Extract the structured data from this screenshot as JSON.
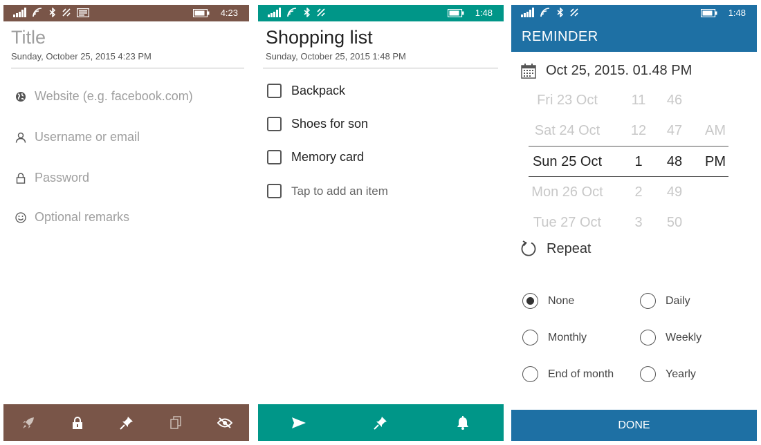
{
  "colors": {
    "brown": "#795548",
    "teal": "#009688",
    "blue": "#1e70a4"
  },
  "screen1": {
    "status": {
      "time": "4:23",
      "icons": [
        "signal-icon",
        "wifi-icon",
        "bluetooth-icon",
        "data-sense-icon",
        "message-icon",
        "battery-icon"
      ]
    },
    "title_placeholder": "Title",
    "date": "Sunday, October 25, 2015 4:23 PM",
    "fields": [
      {
        "icon": "globe-icon",
        "label": "Website (e.g. facebook.com)"
      },
      {
        "icon": "person-icon",
        "label": "Username or email"
      },
      {
        "icon": "lock-icon",
        "label": "Password"
      },
      {
        "icon": "smiley-icon",
        "label": "Optional remarks"
      }
    ],
    "appbar_icons": [
      "rocket-icon",
      "lock-icon",
      "pin-icon",
      "copy-icon",
      "hide-icon"
    ]
  },
  "screen2": {
    "status": {
      "time": "1:48",
      "icons": [
        "signal-icon",
        "wifi-icon",
        "bluetooth-icon",
        "data-sense-icon",
        "battery-icon"
      ]
    },
    "title": "Shopping list",
    "date": "Sunday, October 25, 2015 1:48 PM",
    "items": [
      "Backpack",
      "Shoes for son",
      "Memory card"
    ],
    "add_item_placeholder": "Tap to add an item",
    "appbar_icons": [
      "send-icon",
      "pin-icon",
      "bell-icon"
    ]
  },
  "screen3": {
    "status": {
      "time": "1:48",
      "icons": [
        "signal-icon",
        "wifi-icon",
        "bluetooth-icon",
        "data-sense-icon",
        "battery-icon"
      ]
    },
    "header": "REMINDER",
    "datetime": "Oct 25, 2015. 01.48 PM",
    "picker": [
      {
        "day": "Fri 23 Oct",
        "hour": "11",
        "minute": "46",
        "ampm": ""
      },
      {
        "day": "Sat 24 Oct",
        "hour": "12",
        "minute": "47",
        "ampm": "AM"
      },
      {
        "day": "Sun 25 Oct",
        "hour": "1",
        "minute": "48",
        "ampm": "PM"
      },
      {
        "day": "Mon 26 Oct",
        "hour": "2",
        "minute": "49",
        "ampm": ""
      },
      {
        "day": "Tue 27 Oct",
        "hour": "3",
        "minute": "50",
        "ampm": ""
      }
    ],
    "repeat_label": "Repeat",
    "repeat_options": [
      {
        "label": "None",
        "selected": true
      },
      {
        "label": "Daily",
        "selected": false
      },
      {
        "label": "Monthly",
        "selected": false
      },
      {
        "label": "Weekly",
        "selected": false
      },
      {
        "label": "End of month",
        "selected": false
      },
      {
        "label": "Yearly",
        "selected": false
      }
    ],
    "done_label": "DONE"
  }
}
